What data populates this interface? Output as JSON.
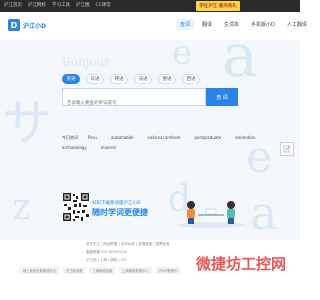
{
  "topbar": {
    "links": [
      "沪江首页",
      "沪江网校",
      "学习工具",
      "沪江圈",
      "CC课堂"
    ],
    "promo_text": "学在沪江 春风有礼"
  },
  "header": {
    "logo_mark": "D",
    "logo_name": "沪江小D",
    "nav": [
      "查词",
      "翻译",
      "生词本",
      "手机版小D",
      "人工翻译"
    ],
    "active_nav_index": 0
  },
  "hero": {
    "deco_letters": [
      "Bonjour",
      "e",
      "a",
      "サ",
      "e",
      "a",
      "z",
      "d"
    ],
    "tabs": [
      "英语",
      "日语",
      "韩语",
      "法语",
      "德语",
      "西语"
    ],
    "active_tab_index": 0,
    "search": {
      "placeholder": "告诉输入要查的单词或句",
      "button_label": "查 词"
    },
    "hot": {
      "label": "今日热词",
      "words": [
        "Peru",
        "automobile",
        "national anthem",
        "postgraduate",
        "animation",
        "archaeology",
        "mineral"
      ]
    },
    "promo": {
      "line1": "扫码下载移动版沪江小D",
      "line2": "随时学词更便捷"
    }
  },
  "side": {
    "icon": "edit-icon"
  },
  "footer": {
    "row1": "关于沪江 | 网站联盟 | 合作伙伴 | 友情链接 | 招聘信息",
    "row2": "客服邮箱 021-60907000",
    "row3": "沪江网 | 上海 | 版权 | ICP",
    "badges": [
      "网上食品交易管理平台",
      "沪江网安备",
      "上海网络监管",
      "上海网络举报中心",
      "沪ICP备案号"
    ]
  },
  "watermark": "微捷坊工控网",
  "colors": {
    "brand": "#2a84e6",
    "topbar": "#2a2a2a",
    "hero_bg": "#f4f8fd"
  }
}
